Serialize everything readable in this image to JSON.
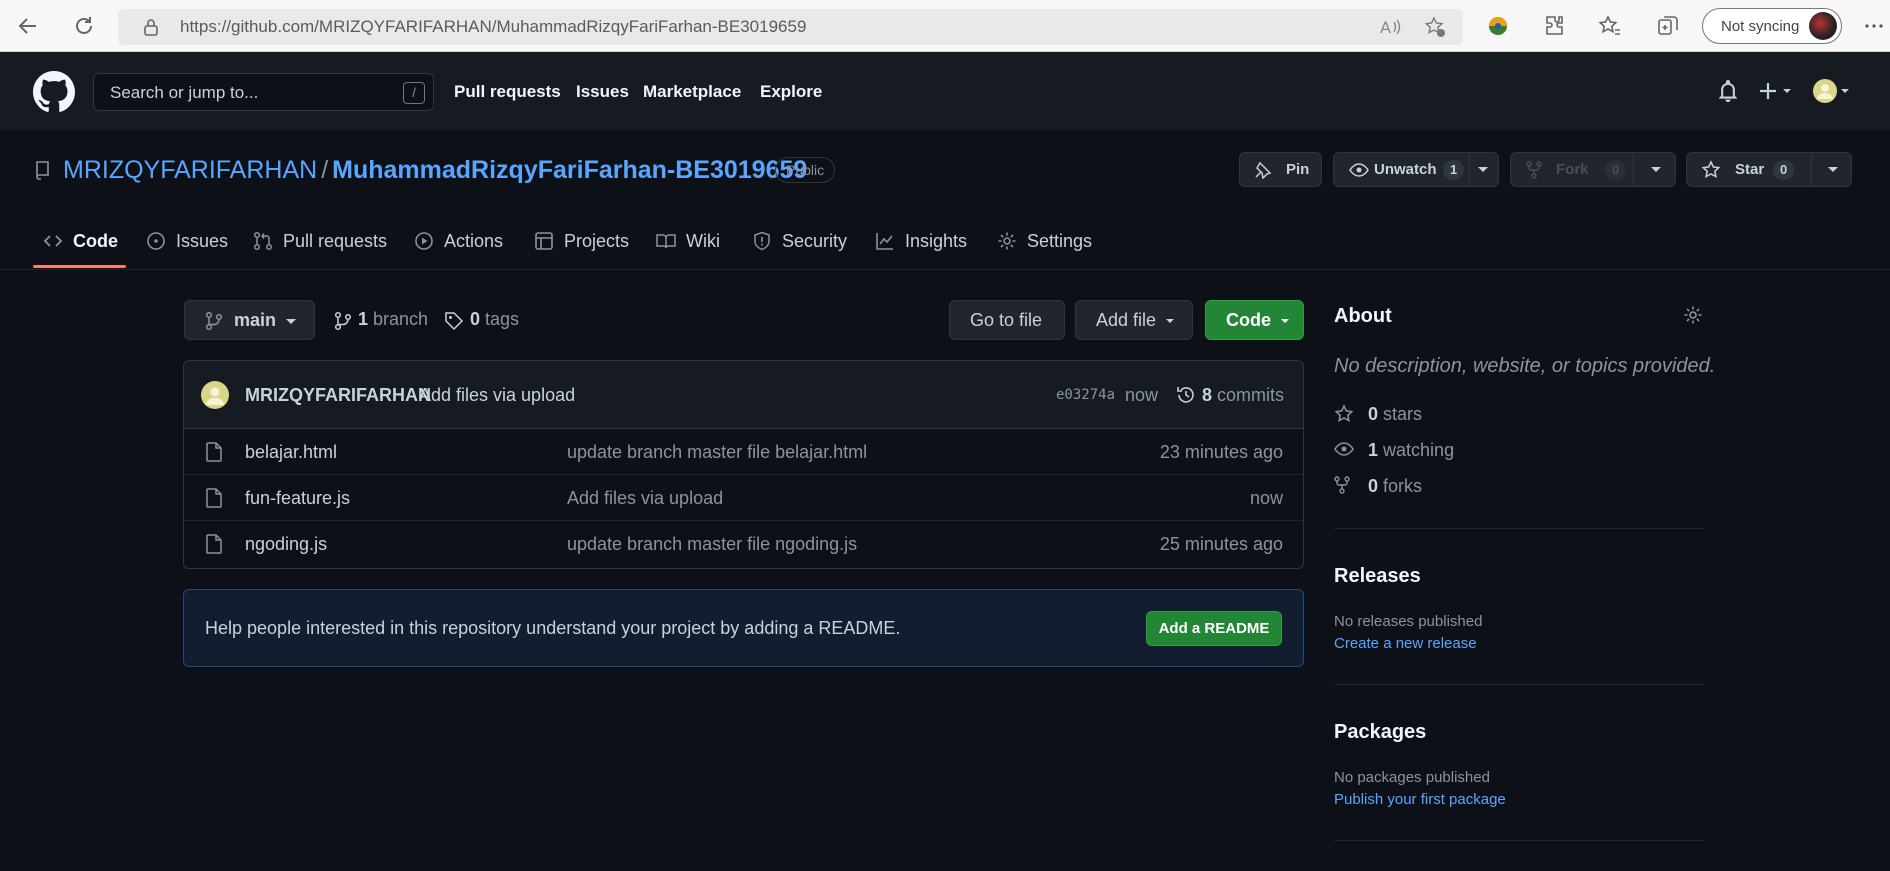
{
  "browser": {
    "url": "https://github.com/MRIZQYFARIFARHAN/MuhammadRizqyFariFarhan-BE3019659",
    "sync_label": "Not syncing"
  },
  "header": {
    "search_placeholder": "Search or jump to...",
    "search_shortcut": "/",
    "nav": [
      "Pull requests",
      "Issues",
      "Marketplace",
      "Explore"
    ]
  },
  "repo": {
    "owner": "MRIZQYFARIFARHAN",
    "separator": "/",
    "name": "MuhammadRizqyFariFarhan-BE3019659",
    "visibility": "Public",
    "pin_label": "Pin",
    "unwatch_label": "Unwatch",
    "watch_count": "1",
    "fork_label": "Fork",
    "fork_count": "0",
    "star_label": "Star",
    "star_count": "0"
  },
  "tabs": [
    "Code",
    "Issues",
    "Pull requests",
    "Actions",
    "Projects",
    "Wiki",
    "Security",
    "Insights",
    "Settings"
  ],
  "branch": {
    "current": "main",
    "branch_count": "1",
    "branch_word": "branch",
    "tag_count": "0",
    "tag_word": "tags",
    "go_to_file": "Go to file",
    "add_file": "Add file",
    "code": "Code"
  },
  "commit": {
    "author": "MRIZQYFARIFARHAN",
    "message": "Add files via upload",
    "sha": "e03274a",
    "time": "now",
    "count": "8",
    "count_word": "commits"
  },
  "files": [
    {
      "name": "belajar.html",
      "message": "update branch master file belajar.html",
      "time": "23 minutes ago"
    },
    {
      "name": "fun-feature.js",
      "message": "Add files via upload",
      "time": "now"
    },
    {
      "name": "ngoding.js",
      "message": "update branch master file ngoding.js",
      "time": "25 minutes ago"
    }
  ],
  "readme": {
    "text": "Help people interested in this repository understand your project by adding a README.",
    "button": "Add a README"
  },
  "about": {
    "title": "About",
    "description": "No description, website, or topics provided.",
    "stars_count": "0",
    "stars_word": "stars",
    "watching_count": "1",
    "watching_word": "watching",
    "forks_count": "0",
    "forks_word": "forks"
  },
  "releases": {
    "title": "Releases",
    "status": "No releases published",
    "link": "Create a new release"
  },
  "packages": {
    "title": "Packages",
    "status": "No packages published",
    "link": "Publish your first package"
  },
  "colors": {
    "background": "#0d1117",
    "header": "#161b22",
    "link": "#58a6ff",
    "green_button": "#238636",
    "tab_underline": "#f78166"
  }
}
